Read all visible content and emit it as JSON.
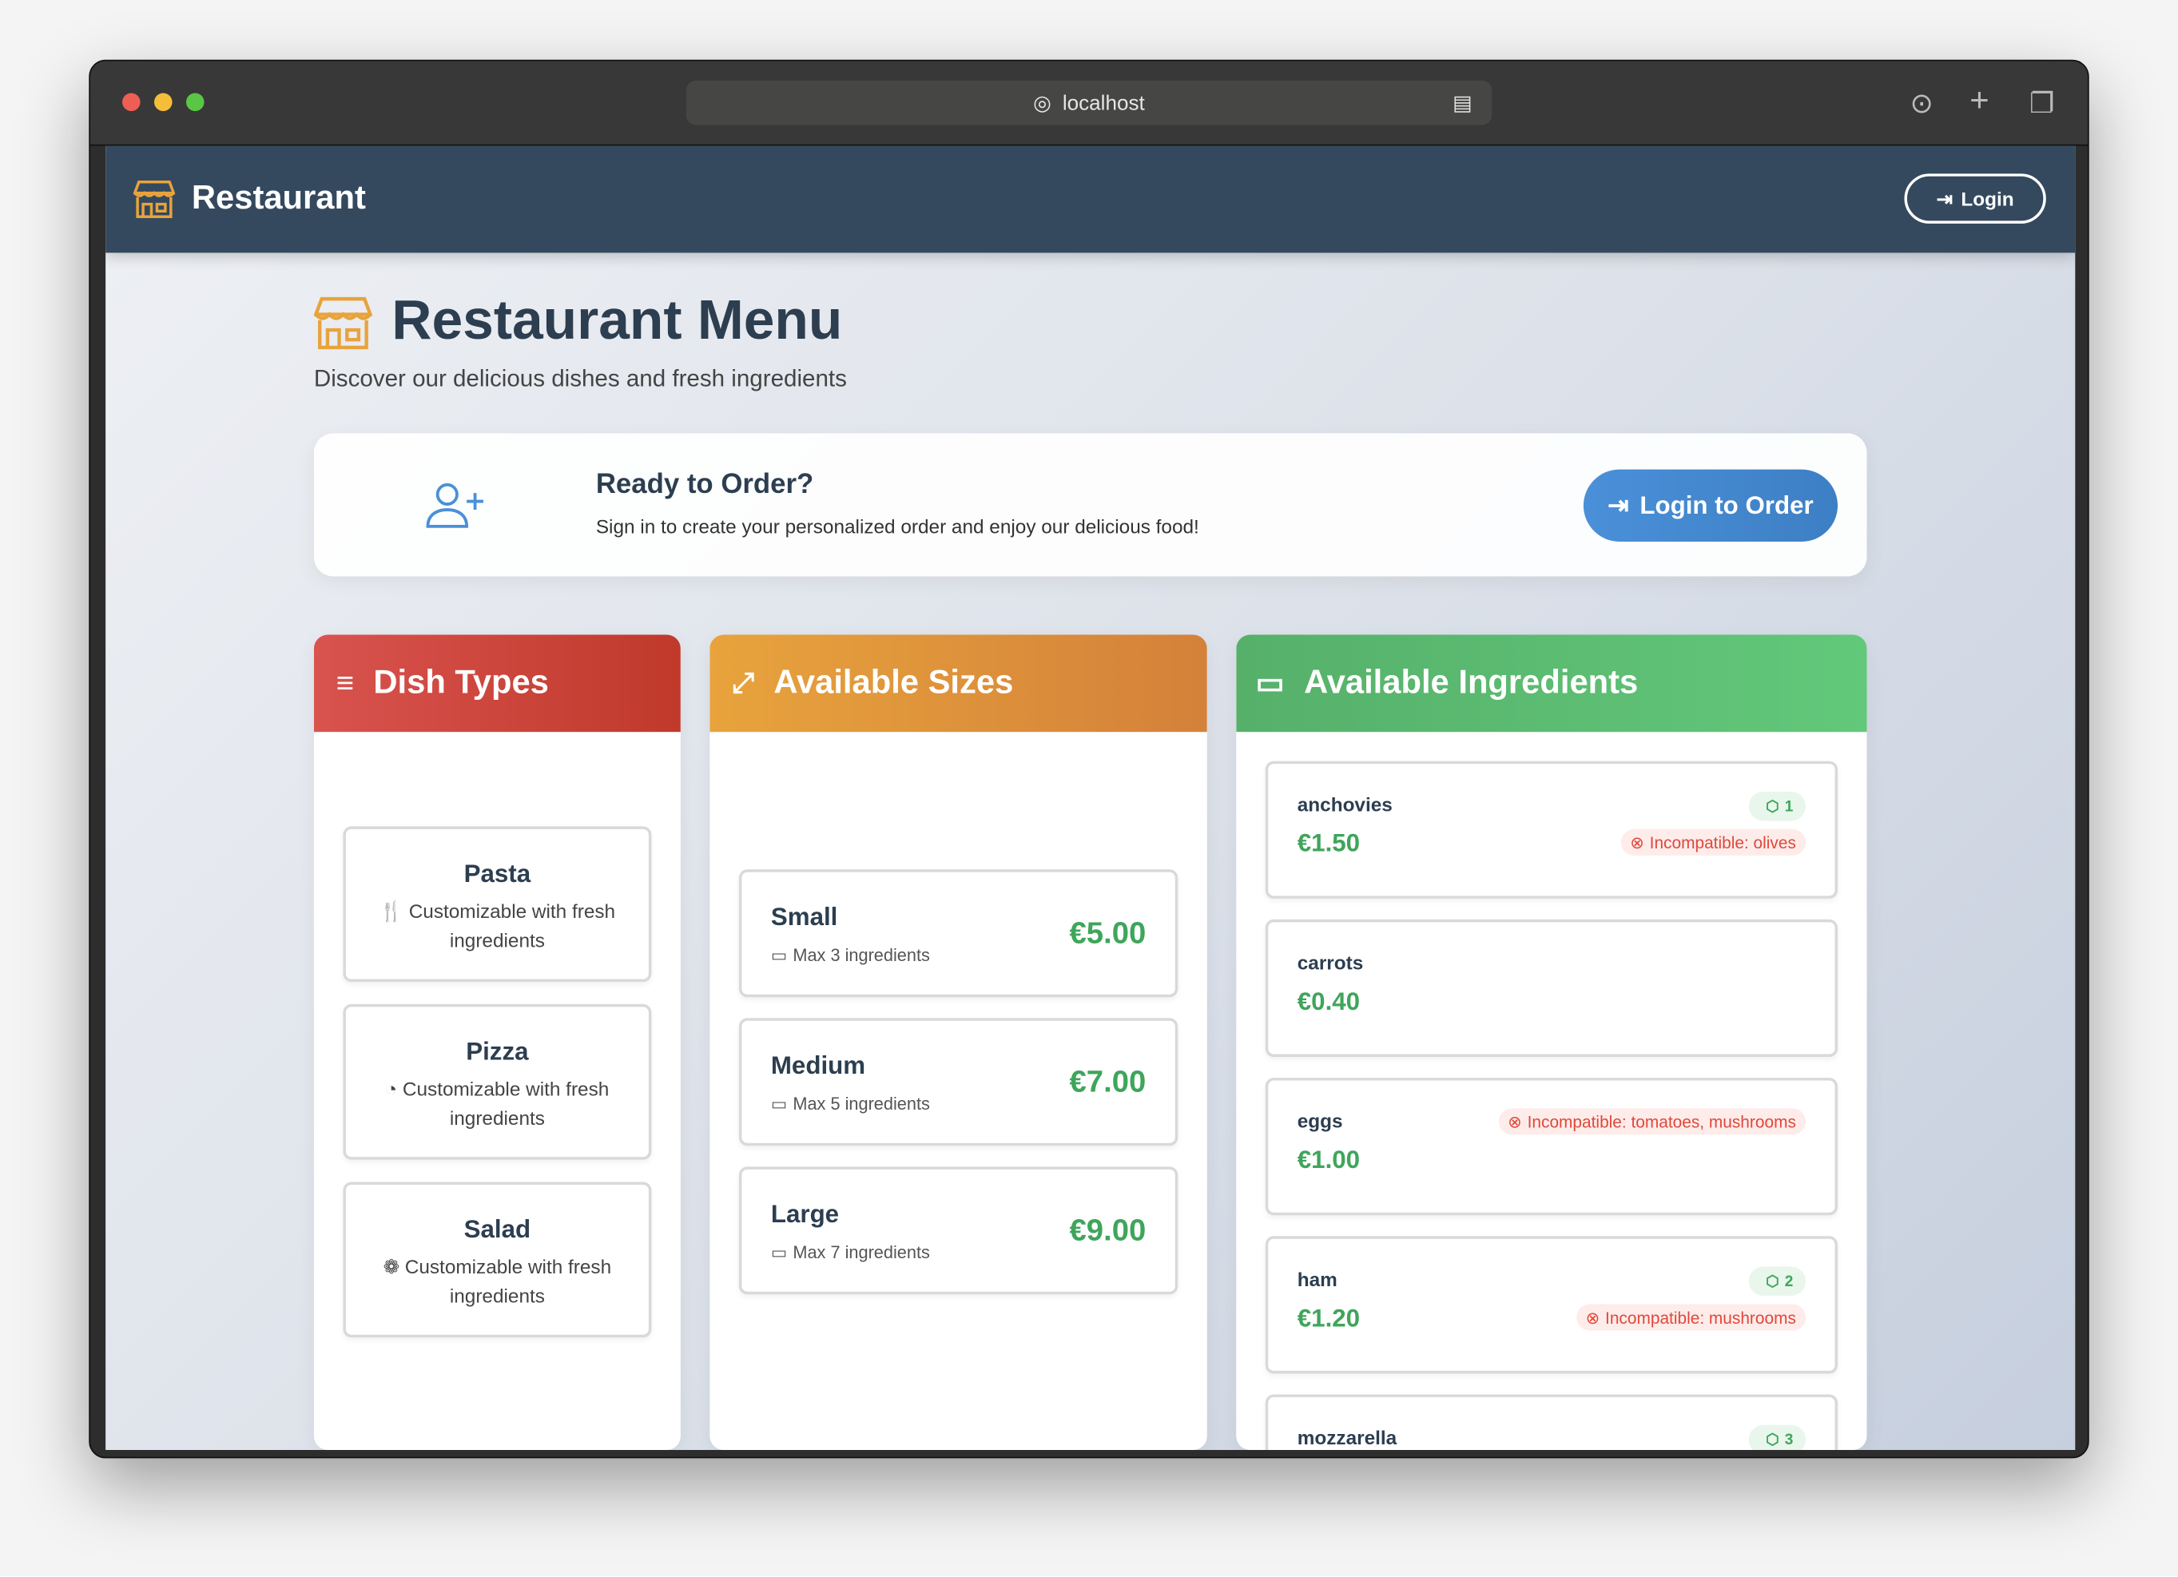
{
  "browser": {
    "url": "localhost"
  },
  "navbar": {
    "brand": "Restaurant",
    "login_label": "Login"
  },
  "header": {
    "title": "Restaurant Menu",
    "subtitle": "Discover our delicious dishes and fresh ingredients"
  },
  "banner": {
    "title": "Ready to Order?",
    "text": "Sign in to create your personalized order and enjoy our delicious food!",
    "button": "Login to Order"
  },
  "dish_types": {
    "title": "Dish Types",
    "items": [
      {
        "name": "Pasta",
        "desc": "Customizable with fresh ingredients",
        "icon": "utensils-icon"
      },
      {
        "name": "Pizza",
        "desc": "Customizable with fresh ingredients",
        "icon": "pizza-icon"
      },
      {
        "name": "Salad",
        "desc": "Customizable with fresh ingredients",
        "icon": "salad-icon"
      }
    ]
  },
  "sizes": {
    "title": "Available Sizes",
    "items": [
      {
        "name": "Small",
        "max": "Max 3 ingredients",
        "price": "€5.00"
      },
      {
        "name": "Medium",
        "max": "Max 5 ingredients",
        "price": "€7.00"
      },
      {
        "name": "Large",
        "max": "Max 7 ingredients",
        "price": "€9.00"
      }
    ]
  },
  "ingredients": {
    "title": "Available Ingredients",
    "items": [
      {
        "name": "anchovies",
        "price": "€1.50",
        "count": "1",
        "incompatible": "Incompatible: olives"
      },
      {
        "name": "carrots",
        "price": "€0.40"
      },
      {
        "name": "eggs",
        "price": "€1.00",
        "incompatible": "Incompatible: tomatoes, mushrooms"
      },
      {
        "name": "ham",
        "price": "€1.20",
        "count": "2",
        "incompatible": "Incompatible: mushrooms"
      },
      {
        "name": "mozzarella",
        "count": "3"
      }
    ]
  },
  "colors": {
    "nav": "#34495e",
    "accent_blue": "#4a90d9",
    "price_green": "#3fa55b",
    "danger": "#e0483a",
    "brand_orange": "#e8a33c"
  }
}
